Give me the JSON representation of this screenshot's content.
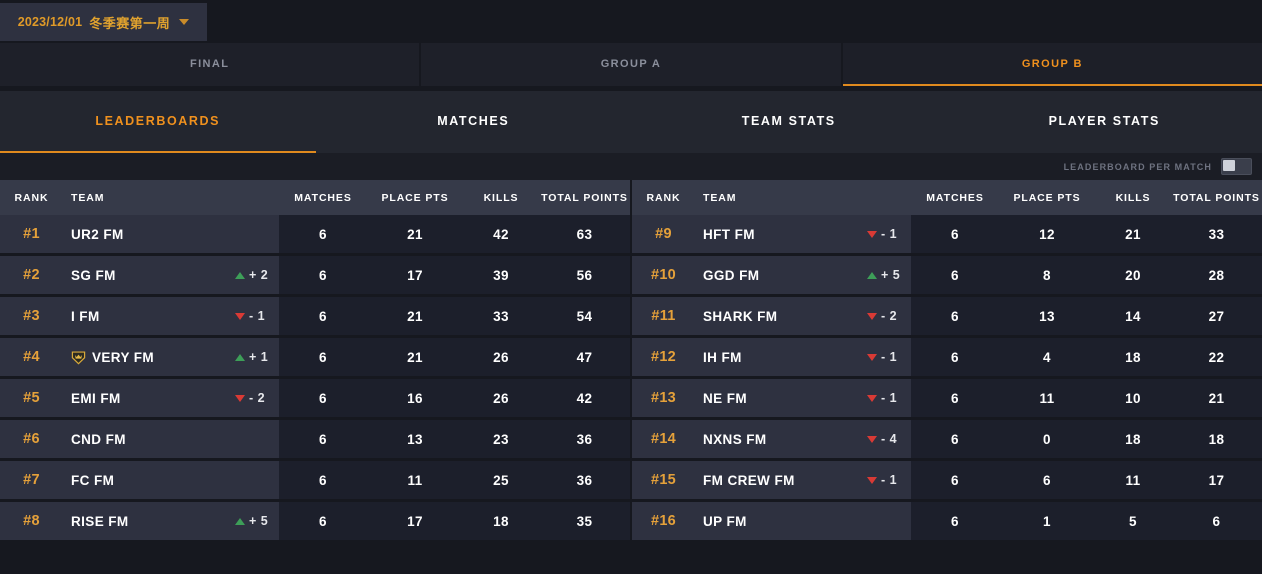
{
  "season": {
    "date": "2023/12/01",
    "name": "冬季赛第一周",
    "caret_icon": "chevron-down-icon"
  },
  "group_tabs": [
    {
      "label": "FINAL",
      "active": false
    },
    {
      "label": "GROUP A",
      "active": false
    },
    {
      "label": "GROUP B",
      "active": true
    }
  ],
  "sub_tabs": [
    {
      "label": "LEADERBOARDS",
      "active": true
    },
    {
      "label": "MATCHES",
      "active": false
    },
    {
      "label": "TEAM STATS",
      "active": false
    },
    {
      "label": "PLAYER STATS",
      "active": false
    }
  ],
  "toggle": {
    "label": "LEADERBOARD PER MATCH",
    "state": "off"
  },
  "colors": {
    "accent_orange": "#f0911e",
    "rank_orange": "#e5a13a",
    "up_green": "#3d9e58",
    "down_red": "#d93a35",
    "panel_light": "#2e3140",
    "panel_dark": "#1c1f2b",
    "header_gray": "#363a49",
    "page_bg": "#16181f"
  },
  "columns": [
    "RANK",
    "TEAM",
    "MATCHES",
    "PLACE PTS",
    "KILLS",
    "TOTAL POINTS"
  ],
  "left_table": {
    "headers": [
      "RANK",
      "TEAM",
      "MATCHES",
      "PLACE PTS",
      "KILLS",
      "TOTAL POINTS"
    ],
    "rows": [
      {
        "rank": "#1",
        "team": "UR2 FM",
        "badge": false,
        "delta": "",
        "dir": "none",
        "matches": "6",
        "place_pts": "21",
        "kills": "42",
        "total_points": "63"
      },
      {
        "rank": "#2",
        "team": "SG FM",
        "badge": false,
        "delta": "+ 2",
        "dir": "up",
        "matches": "6",
        "place_pts": "17",
        "kills": "39",
        "total_points": "56"
      },
      {
        "rank": "#3",
        "team": "I FM",
        "badge": false,
        "delta": "- 1",
        "dir": "down",
        "matches": "6",
        "place_pts": "21",
        "kills": "33",
        "total_points": "54"
      },
      {
        "rank": "#4",
        "team": "VERY FM",
        "badge": true,
        "delta": "+ 1",
        "dir": "up",
        "matches": "6",
        "place_pts": "21",
        "kills": "26",
        "total_points": "47"
      },
      {
        "rank": "#5",
        "team": "EMI FM",
        "badge": false,
        "delta": "- 2",
        "dir": "down",
        "matches": "6",
        "place_pts": "16",
        "kills": "26",
        "total_points": "42"
      },
      {
        "rank": "#6",
        "team": "CND FM",
        "badge": false,
        "delta": "",
        "dir": "none",
        "matches": "6",
        "place_pts": "13",
        "kills": "23",
        "total_points": "36"
      },
      {
        "rank": "#7",
        "team": "FC FM",
        "badge": false,
        "delta": "",
        "dir": "none",
        "matches": "6",
        "place_pts": "11",
        "kills": "25",
        "total_points": "36"
      },
      {
        "rank": "#8",
        "team": "RISE FM",
        "badge": false,
        "delta": "+ 5",
        "dir": "up",
        "matches": "6",
        "place_pts": "17",
        "kills": "18",
        "total_points": "35"
      }
    ]
  },
  "right_table": {
    "headers": [
      "RANK",
      "TEAM",
      "MATCHES",
      "PLACE PTS",
      "KILLS",
      "TOTAL POINTS"
    ],
    "rows": [
      {
        "rank": "#9",
        "team": "HFT FM",
        "badge": false,
        "delta": "- 1",
        "dir": "down",
        "matches": "6",
        "place_pts": "12",
        "kills": "21",
        "total_points": "33"
      },
      {
        "rank": "#10",
        "team": "GGD FM",
        "badge": false,
        "delta": "+ 5",
        "dir": "up",
        "matches": "6",
        "place_pts": "8",
        "kills": "20",
        "total_points": "28"
      },
      {
        "rank": "#11",
        "team": "SHARK FM",
        "badge": false,
        "delta": "- 2",
        "dir": "down",
        "matches": "6",
        "place_pts": "13",
        "kills": "14",
        "total_points": "27"
      },
      {
        "rank": "#12",
        "team": "IH FM",
        "badge": false,
        "delta": "- 1",
        "dir": "down",
        "matches": "6",
        "place_pts": "4",
        "kills": "18",
        "total_points": "22"
      },
      {
        "rank": "#13",
        "team": "NE FM",
        "badge": false,
        "delta": "- 1",
        "dir": "down",
        "matches": "6",
        "place_pts": "11",
        "kills": "10",
        "total_points": "21"
      },
      {
        "rank": "#14",
        "team": "NXNS FM",
        "badge": false,
        "delta": "- 4",
        "dir": "down",
        "matches": "6",
        "place_pts": "0",
        "kills": "18",
        "total_points": "18"
      },
      {
        "rank": "#15",
        "team": "FM CREW FM",
        "badge": false,
        "delta": "- 1",
        "dir": "down",
        "matches": "6",
        "place_pts": "6",
        "kills": "11",
        "total_points": "17"
      },
      {
        "rank": "#16",
        "team": "UP FM",
        "badge": false,
        "delta": "",
        "dir": "none",
        "matches": "6",
        "place_pts": "1",
        "kills": "5",
        "total_points": "6"
      }
    ]
  }
}
